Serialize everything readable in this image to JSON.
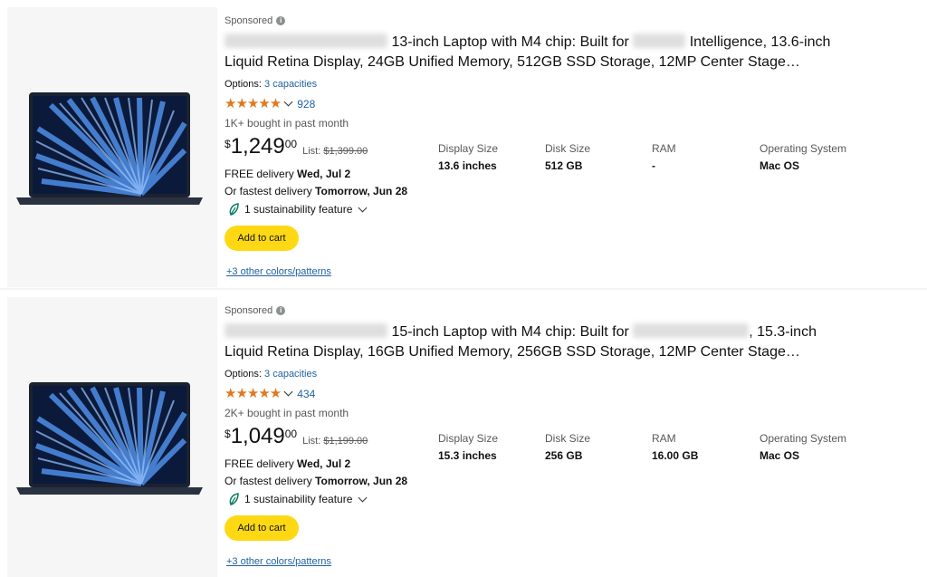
{
  "products": [
    {
      "sponsored": "Sponsored",
      "title_pre": "13-inch Laptop with M4 chip: Built for",
      "title_mid": "Intelligence, 13.6-inch",
      "title_line2": "Liquid Retina Display, 24GB Unified Memory, 512GB SSD Storage, 12MP Center Stage…",
      "options_label": "Options:",
      "options_link": "3 capacities",
      "stars": "★★★★★",
      "rating_count": "928",
      "bought": "1K+ bought in past month",
      "currency": "$",
      "price_whole": "1,249",
      "price_frac": "00",
      "list_label": "List:",
      "list_price": "$1,399.00",
      "delivery_label": "FREE delivery",
      "delivery_date": "Wed, Jul 2",
      "fast_label": "Or fastest delivery",
      "fast_date": "Tomorrow, Jun 28",
      "sustainability": "1 sustainability feature",
      "cart_label": "Add to cart",
      "colors_link": "+3 other colors/patterns",
      "specs": [
        {
          "label": "Display Size",
          "value": "13.6 inches"
        },
        {
          "label": "Disk Size",
          "value": "512 GB"
        },
        {
          "label": "RAM",
          "value": "-"
        },
        {
          "label": "Operating System",
          "value": "Mac OS"
        }
      ]
    },
    {
      "sponsored": "Sponsored",
      "title_pre": "15-inch Laptop with M4 chip: Built for",
      "title_mid": ", 15.3-inch",
      "title_line2": "Liquid Retina Display, 16GB Unified Memory, 256GB SSD Storage, 12MP Center Stage…",
      "options_label": "Options:",
      "options_link": "3 capacities",
      "stars": "★★★★★",
      "rating_count": "434",
      "bought": "2K+ bought in past month",
      "currency": "$",
      "price_whole": "1,049",
      "price_frac": "00",
      "list_label": "List:",
      "list_price": "$1,199.00",
      "delivery_label": "FREE delivery",
      "delivery_date": "Wed, Jul 2",
      "fast_label": "Or fastest delivery",
      "fast_date": "Tomorrow, Jun 28",
      "sustainability": "1 sustainability feature",
      "cart_label": "Add to cart",
      "colors_link": "+3 other colors/patterns",
      "specs": [
        {
          "label": "Display Size",
          "value": "15.3 inches"
        },
        {
          "label": "Disk Size",
          "value": "256 GB"
        },
        {
          "label": "RAM",
          "value": "16.00 GB"
        },
        {
          "label": "Operating System",
          "value": "Mac OS"
        }
      ]
    }
  ],
  "colors": {
    "accent_link": "#2162a1",
    "stars": "#de7921",
    "cart_button": "#ffd814"
  }
}
